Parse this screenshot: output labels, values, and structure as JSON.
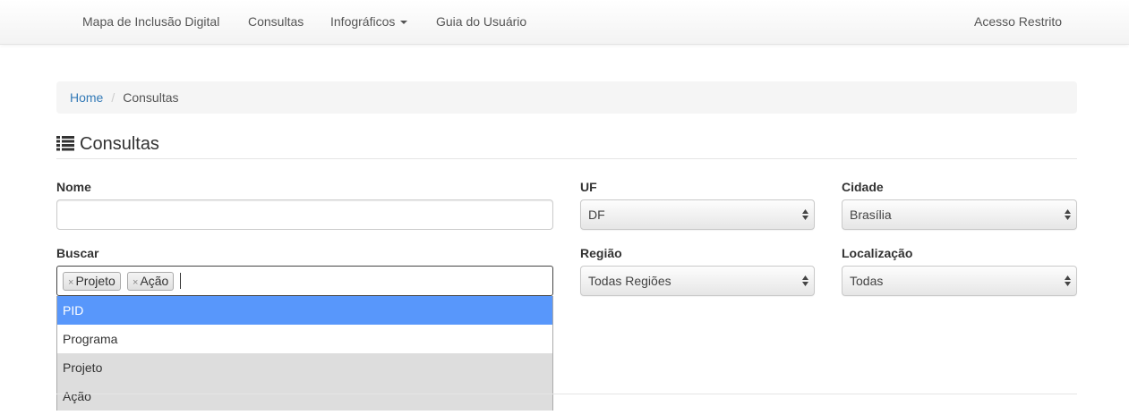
{
  "navbar": {
    "items": [
      "Mapa de Inclusão Digital",
      "Consultas",
      "Infográficos",
      "Guia do Usuário"
    ],
    "right_item": "Acesso Restrito"
  },
  "breadcrumb": {
    "home": "Home",
    "separator": "/",
    "current": "Consultas"
  },
  "page": {
    "title": "Consultas",
    "title_icon": "list-icon"
  },
  "form": {
    "nome": {
      "label": "Nome",
      "value": ""
    },
    "uf": {
      "label": "UF",
      "value": "DF"
    },
    "cidade": {
      "label": "Cidade",
      "value": "Brasília"
    },
    "buscar": {
      "label": "Buscar",
      "selected_tags": [
        "Projeto",
        "Ação"
      ],
      "remove_glyph": "×",
      "options": [
        "PID",
        "Programa",
        "Projeto",
        "Ação"
      ],
      "highlighted_option": "PID"
    },
    "regiao": {
      "label": "Região",
      "value": "Todas Regiões"
    },
    "localizacao": {
      "label": "Localização",
      "value": "Todas"
    }
  },
  "colors": {
    "link": "#337ab7",
    "highlight": "#5897fb",
    "selected_option_bg": "#dddddd"
  }
}
